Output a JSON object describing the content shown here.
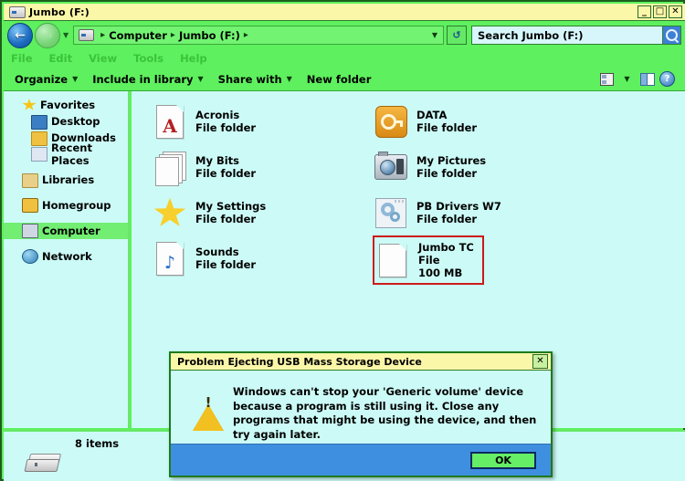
{
  "window": {
    "title": "Jumbo (F:)",
    "title_icon": "drive-icon",
    "controls": {
      "minimize": "_",
      "maximize": "□",
      "close": "✕"
    }
  },
  "address_bar": {
    "back_icon": "back-arrow-icon",
    "forward_icon": "forward-arrow-icon",
    "history_icon": "chevron-down-icon",
    "drive_icon": "drive-icon",
    "crumbs": [
      "Computer",
      "Jumbo (F:)"
    ],
    "separator": "▸",
    "dropdown_icon": "chevron-down-icon",
    "refresh_icon": "refresh-icon",
    "search_value": "Search Jumbo (F:)",
    "search_placeholder": "Search Jumbo (F:)",
    "search_icon": "magnifier-icon"
  },
  "menu_bar": {
    "items": [
      "File",
      "Edit",
      "View",
      "Tools",
      "Help"
    ]
  },
  "toolbar": {
    "items": [
      {
        "label": "Organize",
        "has_caret": true
      },
      {
        "label": "Include in library",
        "has_caret": true
      },
      {
        "label": "Share with",
        "has_caret": true
      },
      {
        "label": "New folder",
        "has_caret": false
      }
    ],
    "right_icons": [
      {
        "name": "change-view-icon"
      },
      {
        "name": "chevron-down-icon"
      },
      {
        "name": "preview-pane-icon"
      },
      {
        "name": "help-icon"
      }
    ]
  },
  "sidebar": {
    "items": [
      {
        "label": "Favorites",
        "icon": "star-icon",
        "level": 0,
        "selected": false
      },
      {
        "label": "Desktop",
        "icon": "desktop-icon",
        "level": 1,
        "selected": false
      },
      {
        "label": "Downloads",
        "icon": "downloads-folder-icon",
        "level": 1,
        "selected": false
      },
      {
        "label": "Recent Places",
        "icon": "recent-places-icon",
        "level": 1,
        "selected": false
      },
      {
        "label": "Libraries",
        "icon": "libraries-icon",
        "level": 0,
        "selected": false
      },
      {
        "label": "Homegroup",
        "icon": "homegroup-icon",
        "level": 0,
        "selected": false
      },
      {
        "label": "Computer",
        "icon": "computer-icon",
        "level": 0,
        "selected": true
      },
      {
        "label": "Network",
        "icon": "network-icon",
        "level": 0,
        "selected": false
      }
    ]
  },
  "files": [
    {
      "name": "Acronis",
      "type": "File folder",
      "size": "",
      "icon": "acronis-document-icon",
      "selected": false
    },
    {
      "name": "DATA",
      "type": "File folder",
      "size": "",
      "icon": "key-folder-icon",
      "selected": false
    },
    {
      "name": "My Bits",
      "type": "File folder",
      "size": "",
      "icon": "documents-stack-icon",
      "selected": false
    },
    {
      "name": "My Pictures",
      "type": "File folder",
      "size": "",
      "icon": "camera-icon",
      "selected": false
    },
    {
      "name": "My Settings",
      "type": "File folder",
      "size": "",
      "icon": "star-folder-icon",
      "selected": false
    },
    {
      "name": "PB Drivers W7",
      "type": "File folder",
      "size": "",
      "icon": "gears-document-icon",
      "selected": false
    },
    {
      "name": "Sounds",
      "type": "File folder",
      "size": "",
      "icon": "music-note-icon",
      "selected": false
    },
    {
      "name": "Jumbo TC",
      "type": "File",
      "size": "100 MB",
      "icon": "blank-document-icon",
      "selected": true
    }
  ],
  "status": {
    "items_count": "8 items",
    "drive_icon": "hard-drive-icon"
  },
  "dialog": {
    "title": "Problem Ejecting USB Mass Storage Device",
    "close_label": "✕",
    "warning_icon": "warning-triangle-icon",
    "message": "Windows can't stop your 'Generic volume' device because a program is still using it. Close any programs that might be using the device, and then try again later.",
    "ok_label": "OK"
  },
  "colors": {
    "window_frame": "#5ef05e",
    "titlebar": "#fbf7a8",
    "content": "#ccfbf7",
    "selection_red": "#cc1a1a",
    "dialog_footer": "#3f8fe0",
    "sidebar_selected": "#72ee72"
  }
}
